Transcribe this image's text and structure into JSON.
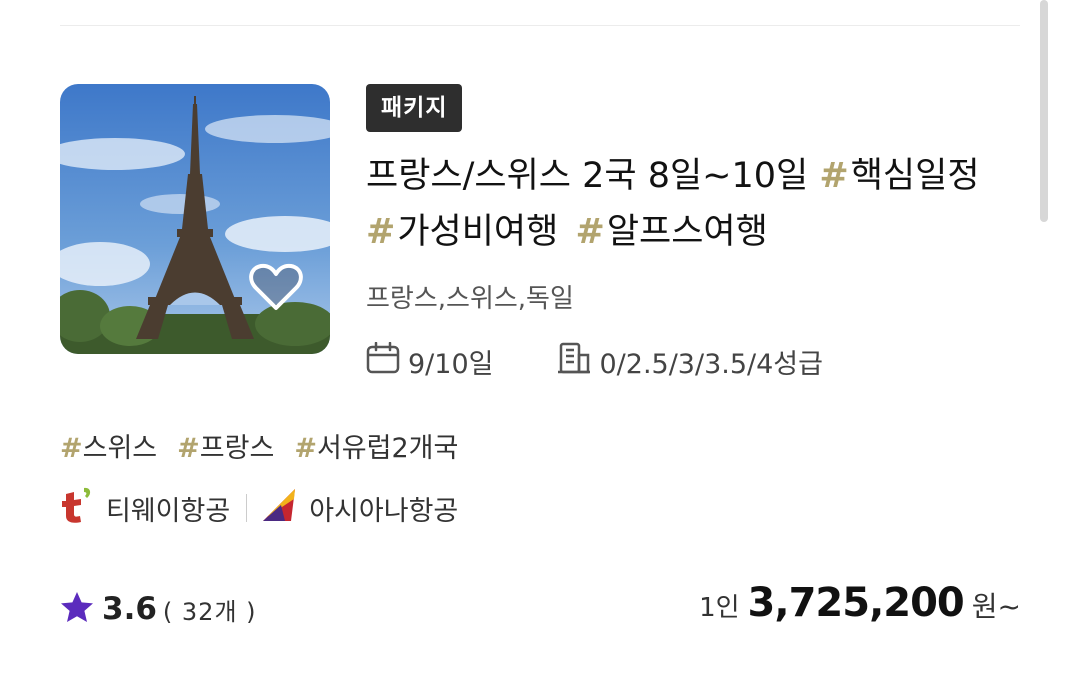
{
  "product": {
    "badge": "패키지",
    "title_main": "프랑스/스위스 2국 8일~10일",
    "title_tags": [
      "핵심일정",
      "가성비여행",
      "알프스여행"
    ],
    "hash_symbol": "#",
    "countries": "프랑스,스위스,독일",
    "duration": "9/10일",
    "hotel_grade": "0/2.5/3/3.5/4성급",
    "tags": [
      "스위스",
      "프랑스",
      "서유럽2개국"
    ],
    "airlines": [
      {
        "name": "티웨이항공",
        "icon": "tway-logo-icon"
      },
      {
        "name": "아시아나항공",
        "icon": "asiana-logo-icon"
      }
    ],
    "rating": {
      "score": "3.6",
      "count": "( 32개 )"
    },
    "price": {
      "prefix": "1인",
      "amount": "3,725,200",
      "suffix": "원~"
    },
    "image_icon": "eiffel-tower-photo",
    "favorite_icon": "heart-icon"
  },
  "colors": {
    "hash": "#b2a46e",
    "badge_bg": "#2e2e2e",
    "star": "#5b2bbd",
    "tway": "#c8362e"
  }
}
